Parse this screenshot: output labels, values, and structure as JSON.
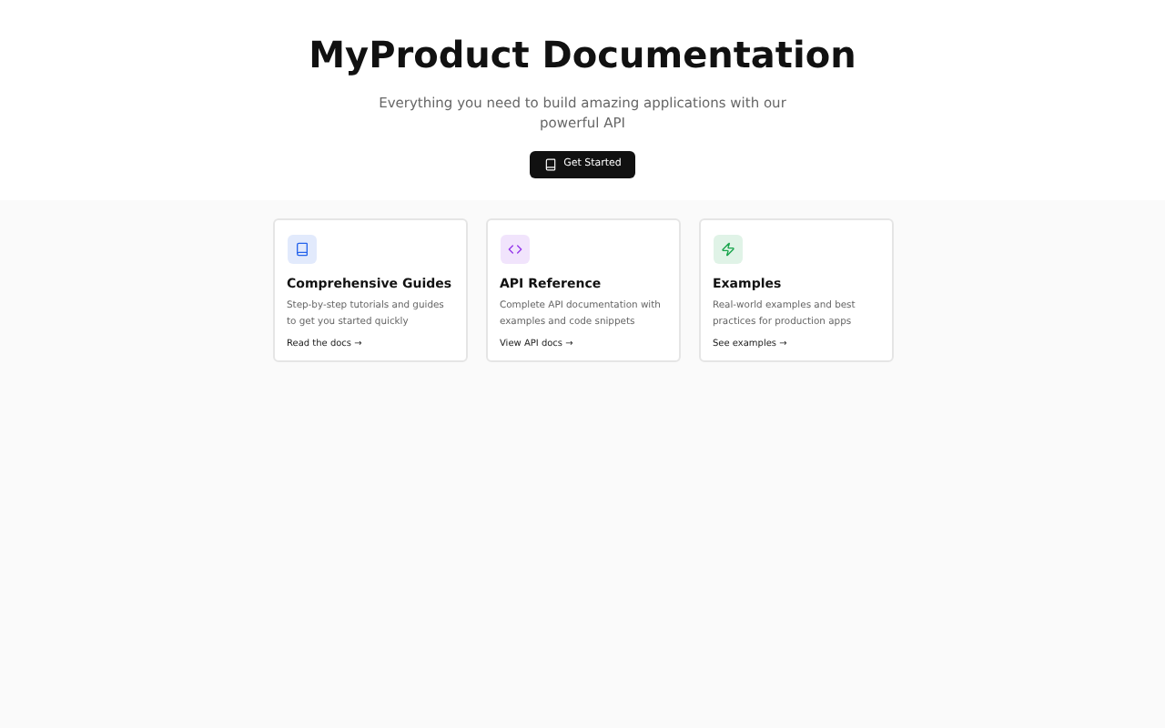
{
  "hero": {
    "title": "MyProduct Documentation",
    "subtitle": "Everything you need to build amazing applications with our powerful API",
    "button": "Get Started"
  },
  "cards": [
    {
      "kind": "book",
      "color": "#2563eb",
      "title": "Comprehensive Guides",
      "description": "Step-by-step tutorials and guides to get you started quickly",
      "link": "Read the docs →"
    },
    {
      "kind": "code",
      "color": "#9333ea",
      "title": "API Reference",
      "description": "Complete API documentation with examples and code snippets",
      "link": "View API docs →"
    },
    {
      "kind": "spark",
      "color": "#16a34a",
      "title": "Examples",
      "description": "Real-world examples and best practices for production apps",
      "link": "See examples →"
    }
  ]
}
